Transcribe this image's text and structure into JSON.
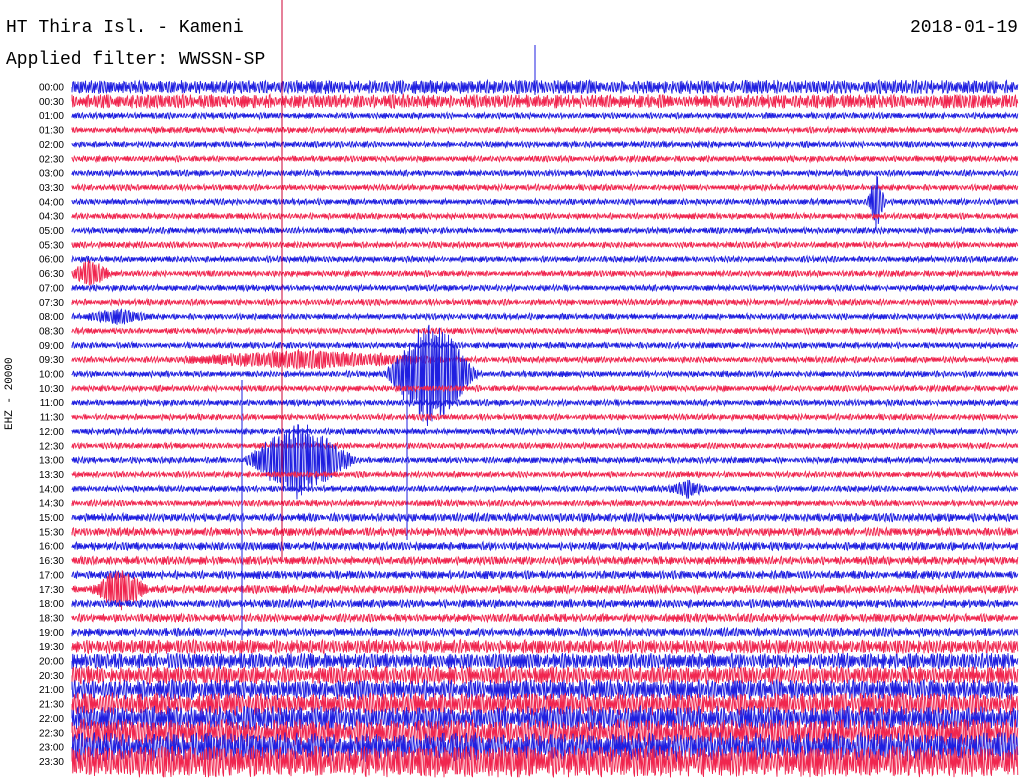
{
  "header": {
    "station": "HT Thira Isl. - Kameni",
    "date": "2018-01-19",
    "filter": "Applied filter: WWSSN-SP"
  },
  "channel_label": "EHZ - 20000",
  "colors": {
    "blue": "#1f1fe0",
    "red": "#f0264f",
    "marker": "#cc0033"
  },
  "time_labels": [
    "00:00",
    "00:30",
    "01:00",
    "01:30",
    "02:00",
    "02:30",
    "03:00",
    "03:30",
    "04:00",
    "04:30",
    "05:00",
    "05:30",
    "06:00",
    "06:30",
    "07:00",
    "07:30",
    "08:00",
    "08:30",
    "09:00",
    "09:30",
    "10:00",
    "10:30",
    "11:00",
    "11:30",
    "12:00",
    "12:30",
    "13:00",
    "13:30",
    "14:00",
    "14:30",
    "15:00",
    "15:30",
    "16:00",
    "16:30",
    "17:00",
    "17:30",
    "18:00",
    "18:30",
    "19:00",
    "19:30",
    "20:00",
    "20:30",
    "21:00",
    "21:30",
    "22:00",
    "22:30",
    "23:00",
    "23:30"
  ],
  "events": [
    {
      "row": 13,
      "time_fraction": 0.02,
      "amplitude": 16,
      "width": 0.02
    },
    {
      "row": 16,
      "time_fraction": 0.05,
      "amplitude": 6,
      "width": 0.04
    },
    {
      "row": 19,
      "time_fraction": 0.25,
      "amplitude": 8,
      "width": 0.15
    },
    {
      "row": 20,
      "time_fraction": 0.38,
      "amplitude": 60,
      "width": 0.05
    },
    {
      "row": 26,
      "time_fraction": 0.24,
      "amplitude": 40,
      "width": 0.06
    },
    {
      "row": 28,
      "time_fraction": 0.65,
      "amplitude": 10,
      "width": 0.02
    },
    {
      "row": 35,
      "time_fraction": 0.05,
      "amplitude": 22,
      "width": 0.03
    },
    {
      "row": 8,
      "time_fraction": 0.85,
      "amplitude": 30,
      "width": 0.01
    }
  ]
}
